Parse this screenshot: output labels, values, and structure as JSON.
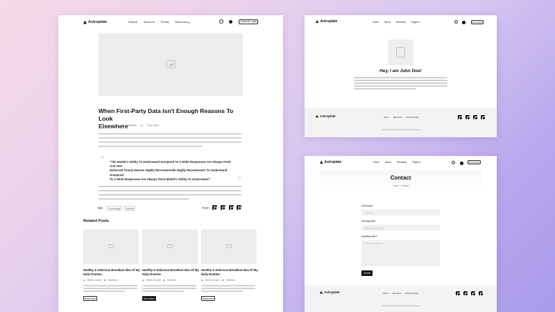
{
  "brand": "Astroplate",
  "blog_page": {
    "nav": [
      "Feature",
      "About Us",
      "Pricing",
      "Resources"
    ],
    "cta": "Customer Login",
    "title_line1": "When First-Party Data Isn't Enough Reasons To Look",
    "title_line2": "Elsewhere",
    "meta_author": "Jacob Jones",
    "meta_category": "Business",
    "meta_date": "04 Apr 2022",
    "quote_line1": "\"The Model's Ability To Understand Arespond To A Wide Responses Are Always Point And One",
    "quote_line2": "Delivered Timely Manner Highly Recommendin Highly Recommend. To Understand Arespond",
    "quote_line3": "To A Wide Responses Are Always Point Model's Ability To Understand \"",
    "tags_label": "Tags :",
    "tags": [
      "Technology",
      "General"
    ],
    "share_label": "Share :",
    "related_heading": "Related Posts",
    "related_posts": [
      {
        "title_line1": "Healthy & Delicious Breakfast Idea Of My",
        "title_line2": "Daily Routine .",
        "author": "Mason Cooper",
        "category": "Business",
        "button": "Read More",
        "button_style": "outline"
      },
      {
        "title_line1": "Healthy & Delicious Breakfast Idea Of My",
        "title_line2": "Daily Routine .",
        "author": "Mason Cooper",
        "category": "Business",
        "button": "Read More",
        "button_style": "filled"
      },
      {
        "title_line1": "Healthy & Delicious Breakfast Idea Of My",
        "title_line2": "Daily Routine .",
        "author": "Mason Cooper",
        "category": "Business",
        "button": "Read More",
        "button_style": "outline"
      }
    ]
  },
  "author_page": {
    "nav": [
      "Home",
      "About",
      "Elements",
      "Pages"
    ],
    "cta": "Get Started",
    "heading": "Hey, I am John Doe!",
    "footer_links": [
      "About",
      "Elements",
      "Privacy Policy"
    ]
  },
  "contact_page": {
    "nav": [
      "Home",
      "About",
      "Elements",
      "Pages"
    ],
    "cta": "Get Started",
    "heading": "Contact",
    "breadcrumb_home": "Home",
    "breadcrumb_sep": "/",
    "breadcrumb_current": "Contact",
    "full_name_label": "Full Name",
    "full_name_placeholder": "John Doe",
    "email_label": "Working Mail",
    "email_placeholder": "john.doe@email.com",
    "message_label": "Anything else?",
    "message_placeholder": "Message goes here...",
    "submit": "Submit",
    "footer_links": [
      "About",
      "Elements",
      "Privacy Policy"
    ]
  }
}
